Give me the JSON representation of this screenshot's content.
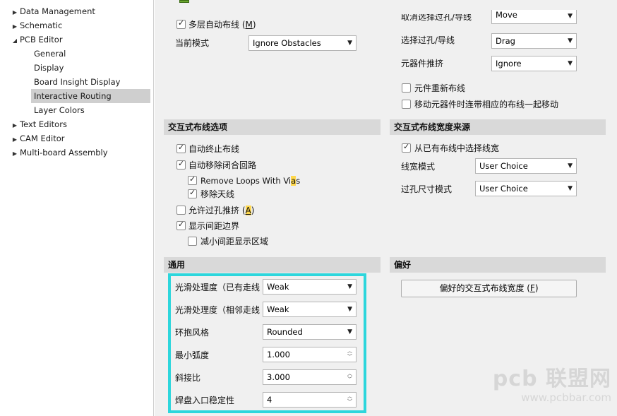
{
  "tree": {
    "items": [
      {
        "label": "Data Management",
        "arrow": "▶"
      },
      {
        "label": "Schematic",
        "arrow": "▶"
      },
      {
        "label": "PCB Editor",
        "arrow": "◢"
      },
      {
        "label": "General",
        "arrow": ""
      },
      {
        "label": "Display",
        "arrow": ""
      },
      {
        "label": "Board Insight Display",
        "arrow": ""
      },
      {
        "label": "Interactive Routing",
        "arrow": ""
      },
      {
        "label": "Layer Colors",
        "arrow": ""
      },
      {
        "label": "Text Editors",
        "arrow": "▶"
      },
      {
        "label": "CAM Editor",
        "arrow": "▶"
      },
      {
        "label": "Multi-board Assembly",
        "arrow": "▶"
      }
    ]
  },
  "top": {
    "multilayer_label": "多层自动布线 (",
    "multilayer_key": "M",
    "multilayer_tail": ")",
    "current_mode_label": "当前模式",
    "current_mode_value": "Ignore Obstacles",
    "cancel_via_label": "取消选择过孔/导线",
    "cancel_via_value": "Move",
    "select_via_label": "选择过孔/导线",
    "select_via_value": "Drag",
    "component_push_label": "元器件推挤",
    "component_push_value": "Ignore",
    "reroute_label": "元件重新布线",
    "move_with_label": "移动元器件时连带相应的布线一起移动"
  },
  "options": {
    "title": "交互式布线选项",
    "auto_terminate": "自动终止布线",
    "auto_remove_loops": "自动移除闭合回路",
    "remove_loops_vias_pre": "Remove Loops With Vi",
    "remove_loops_vias_key": "a",
    "remove_loops_vias_post": "s",
    "remove_antenna": "移除天线",
    "allow_via_push_pre": "允许过孔推挤 (",
    "allow_via_push_key": "A",
    "allow_via_push_post": ")",
    "show_clearance": "显示间距边界",
    "reduce_clearance": "减小间距显示区域"
  },
  "width_source": {
    "title": "交互式布线宽度来源",
    "pick_existing": "从已有布线中选择线宽",
    "width_mode_label": "线宽模式",
    "width_mode_value": "User Choice",
    "via_size_label": "过孔尺寸模式",
    "via_size_value": "User Choice"
  },
  "general": {
    "title": "通用",
    "smooth_existing_label": "光滑处理度（已有走线",
    "smooth_existing_value": "Weak",
    "smooth_adjacent_label": "光滑处理度（相邻走线",
    "smooth_adjacent_value": "Weak",
    "hug_style_label": "环抱风格",
    "hug_style_value": "Rounded",
    "min_arc_label": "最小弧度",
    "min_arc_value": "1.000",
    "miter_label": "斜接比",
    "miter_value": "3.000",
    "pad_entry_label": "焊盘入口稳定性",
    "pad_entry_value": "4"
  },
  "prefs": {
    "title": "偏好",
    "button_label": "偏好的交互式布线宽度 (",
    "button_key": "F",
    "button_tail": ")"
  },
  "watermark": {
    "big": "pcb 联盟网",
    "small": "www.pcbbar.com"
  },
  "colors": {
    "highlight_frame": "#2dd6dc",
    "selected_item": "#cfcfcf",
    "section_header": "#d9d9d9"
  }
}
